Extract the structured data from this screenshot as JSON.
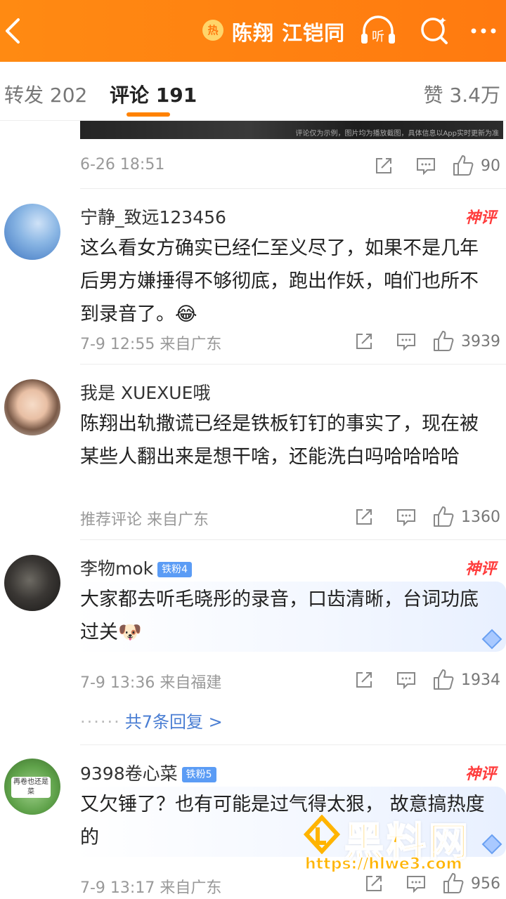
{
  "header": {
    "hot_badge": "热",
    "title": "陈翔 江铠同",
    "listen_label": "听"
  },
  "tabs": {
    "repost": "转发 202",
    "comment": "评论 191",
    "like": "赞 3.4万"
  },
  "clipped_image_caption": "评论仅为示例，图片均为播放截图，具体信息以App实时更新为准",
  "top_item": {
    "meta": "6-26 18:51",
    "likes": "90"
  },
  "comments": [
    {
      "user": "宁静_致远123456",
      "badge": "",
      "tag": "神评",
      "text": "这么看女方确实已经仁至义尽了，如果不是几年后男方嫌捶得不够彻底，跑出作妖，咱们也所不到录音了。😂",
      "meta": "7-9 12:55 来自广东",
      "likes": "3939"
    },
    {
      "user": "我是 XUEXUE哦",
      "badge": "",
      "tag": "",
      "text": "陈翔出轨撒谎已经是铁板钉钉的事实了，现在被某些人翻出来是想干啥，还能洗白吗哈哈哈哈",
      "meta": "推荐评论 来自广东",
      "likes": "1360"
    },
    {
      "user": "李物mok",
      "badge": "铁粉4",
      "tag": "神评",
      "text": "大家都去听毛晓彤的录音，口齿清晰，台词功底过关🐶",
      "meta": "7-9 13:36 来自福建",
      "likes": "1934",
      "replies": "共7条回复 >"
    },
    {
      "user": "9398卷心菜",
      "badge": "铁粉5",
      "tag": "神评",
      "text": "又欠锤了？也有可能是过气得太狠， 故意搞热度的",
      "meta": "7-9 13:17 来自广东",
      "likes": "956"
    }
  ],
  "avatar4_sign": "再卷也还是菜",
  "watermark": {
    "name": "黑料网",
    "url": "https://hlwe3.com"
  },
  "colors": {
    "accent": "#ff8200",
    "link": "#4a7ed3",
    "shenping": "#ff3d3d"
  }
}
